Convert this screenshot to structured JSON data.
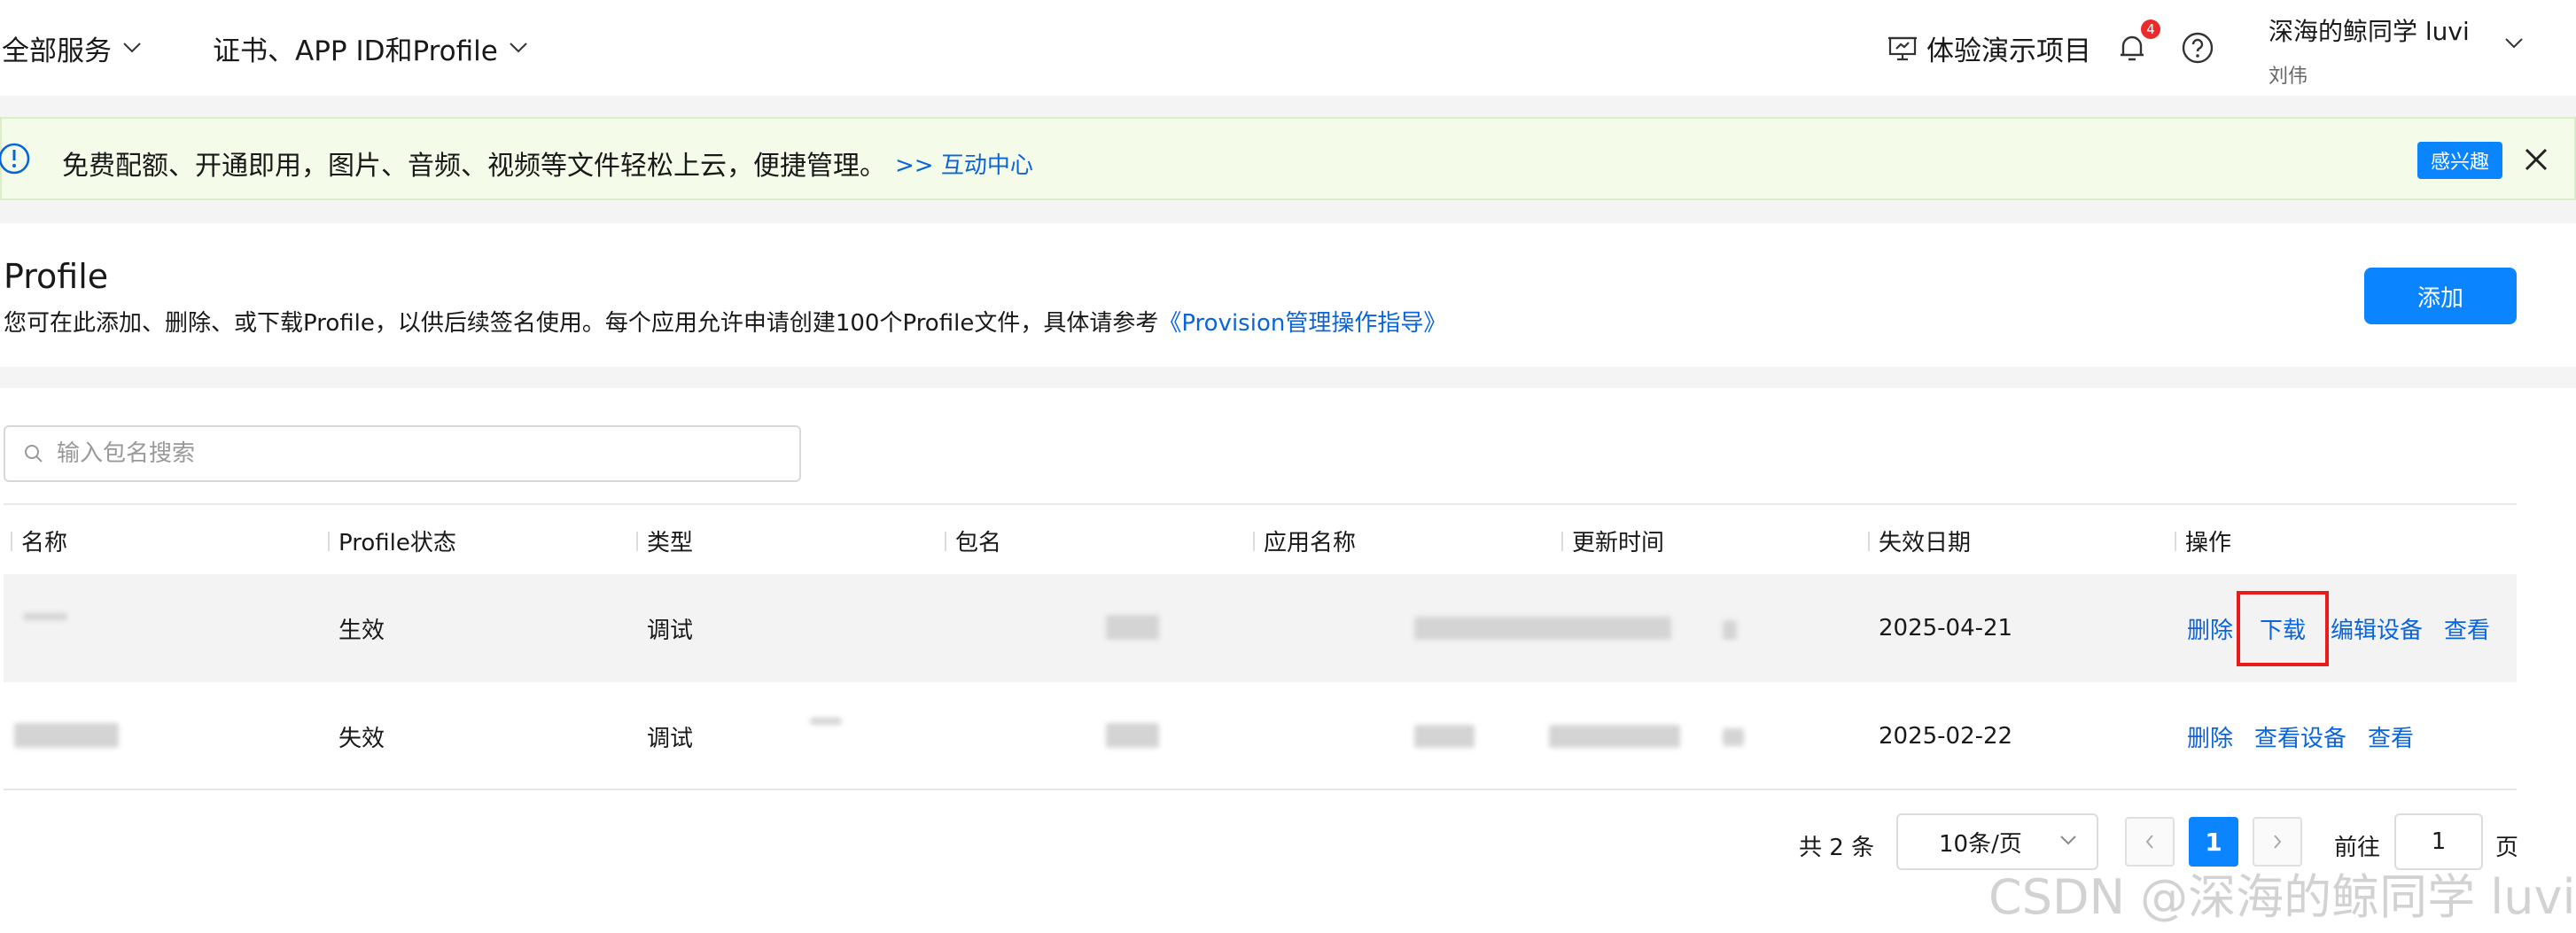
{
  "nav": {
    "all_services": "全部服务",
    "certs": "证书、APP ID和Profile",
    "demo": "体验演示项目",
    "notification_count": "4",
    "user_name": "深海的鲸同学 luvi",
    "user_sub": "刘伟"
  },
  "banner": {
    "text": "免费配额、开通即用，图片、音频、视频等文件轻松上云，便捷管理。",
    "link": ">> 互动中心",
    "interest_button": "感兴趣"
  },
  "header": {
    "title": "Profile",
    "description": "您可在此添加、删除、或下载Profile，以供后续签名使用。每个应用允许申请创建100个Profile文件，具体请参考",
    "guide_link": "《Provision管理操作指导》",
    "add_button": "添加"
  },
  "search": {
    "placeholder": "输入包名搜索"
  },
  "table": {
    "columns": [
      "名称",
      "Profile状态",
      "类型",
      "包名",
      "应用名称",
      "更新时间",
      "失效日期",
      "操作"
    ],
    "rows": [
      {
        "status": "生效",
        "type": "调试",
        "expiry": "2025-04-21",
        "actions": [
          "删除",
          "下载",
          "编辑设备",
          "查看"
        ]
      },
      {
        "status": "失效",
        "type": "调试",
        "expiry": "2025-02-22",
        "actions": [
          "删除",
          "查看设备",
          "查看"
        ]
      }
    ]
  },
  "pagination": {
    "total": "共 2 条",
    "page_size": "10条/页",
    "current_page": "1",
    "goto_label": "前往",
    "goto_value": "1",
    "page_unit": "页"
  },
  "watermark": "CSDN @深海的鲸同学 luvi",
  "colors": {
    "accent": "#0a84ff",
    "link": "#0a64dc",
    "highlight": "#e81c1c",
    "banner_bg": "#f4fbe9"
  }
}
